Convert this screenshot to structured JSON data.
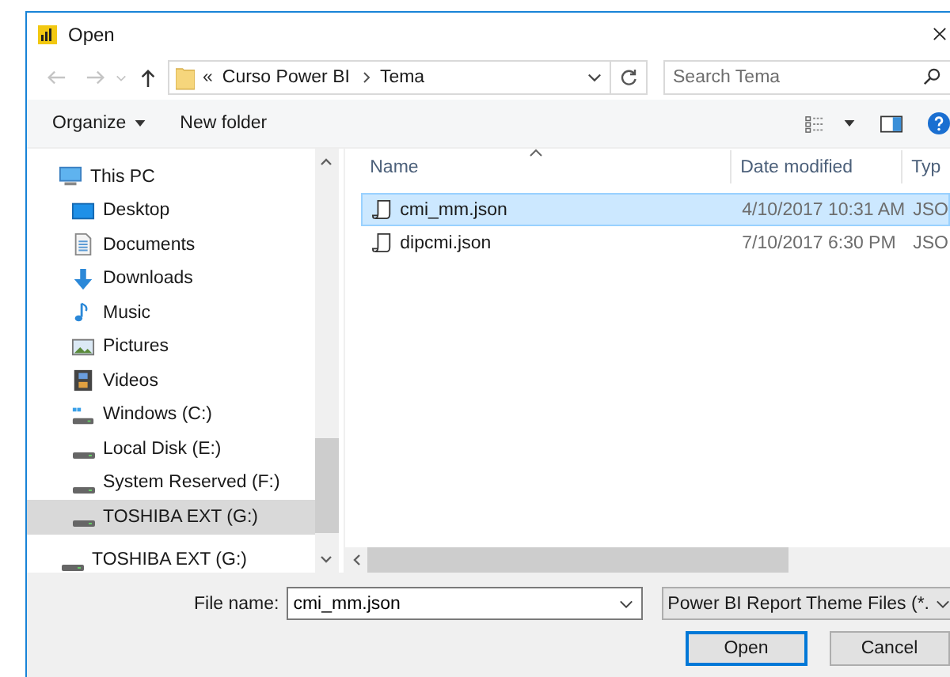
{
  "window": {
    "title": "Open"
  },
  "address": {
    "overflow": "«",
    "crumbs": [
      "Curso Power BI",
      "Tema"
    ]
  },
  "search": {
    "placeholder": "Search Tema"
  },
  "toolbar": [
    {
      "label": "Organize",
      "dropdown": true
    },
    {
      "label": "New folder",
      "dropdown": false
    }
  ],
  "nav": [
    {
      "label": "This PC",
      "kind": "pc",
      "selected": false,
      "children": [
        {
          "label": "Desktop",
          "kind": "desktop",
          "selected": false
        },
        {
          "label": "Documents",
          "kind": "documents",
          "selected": false
        },
        {
          "label": "Downloads",
          "kind": "downloads",
          "selected": false
        },
        {
          "label": "Music",
          "kind": "music",
          "selected": false
        },
        {
          "label": "Pictures",
          "kind": "pictures",
          "selected": false
        },
        {
          "label": "Videos",
          "kind": "videos",
          "selected": false
        },
        {
          "label": "Windows (C:)",
          "kind": "system-drive",
          "selected": false
        },
        {
          "label": "Local Disk (E:)",
          "kind": "drive",
          "selected": false
        },
        {
          "label": "System Reserved (F:)",
          "kind": "drive",
          "selected": false
        },
        {
          "label": "TOSHIBA EXT (G:)",
          "kind": "drive",
          "selected": true
        }
      ]
    },
    {
      "label": "TOSHIBA EXT (G:)",
      "kind": "drive",
      "selected": false
    }
  ],
  "table": {
    "columns": [
      "Name",
      "Date modified",
      "Typ"
    ],
    "rows": [
      {
        "name": "cmi_mm.json",
        "date": "4/10/2017 10:31 AM",
        "type": "JSO",
        "selected": true
      },
      {
        "name": "dipcmi.json",
        "date": "7/10/2017 6:30 PM",
        "type": "JSO",
        "selected": false
      }
    ]
  },
  "file_name": {
    "label": "File name:",
    "value": "cmi_mm.json"
  },
  "filter": {
    "value": "Power BI Report Theme Files (*."
  },
  "buttons": [
    {
      "label": "Open",
      "default": true
    },
    {
      "label": "Cancel",
      "default": false
    }
  ]
}
